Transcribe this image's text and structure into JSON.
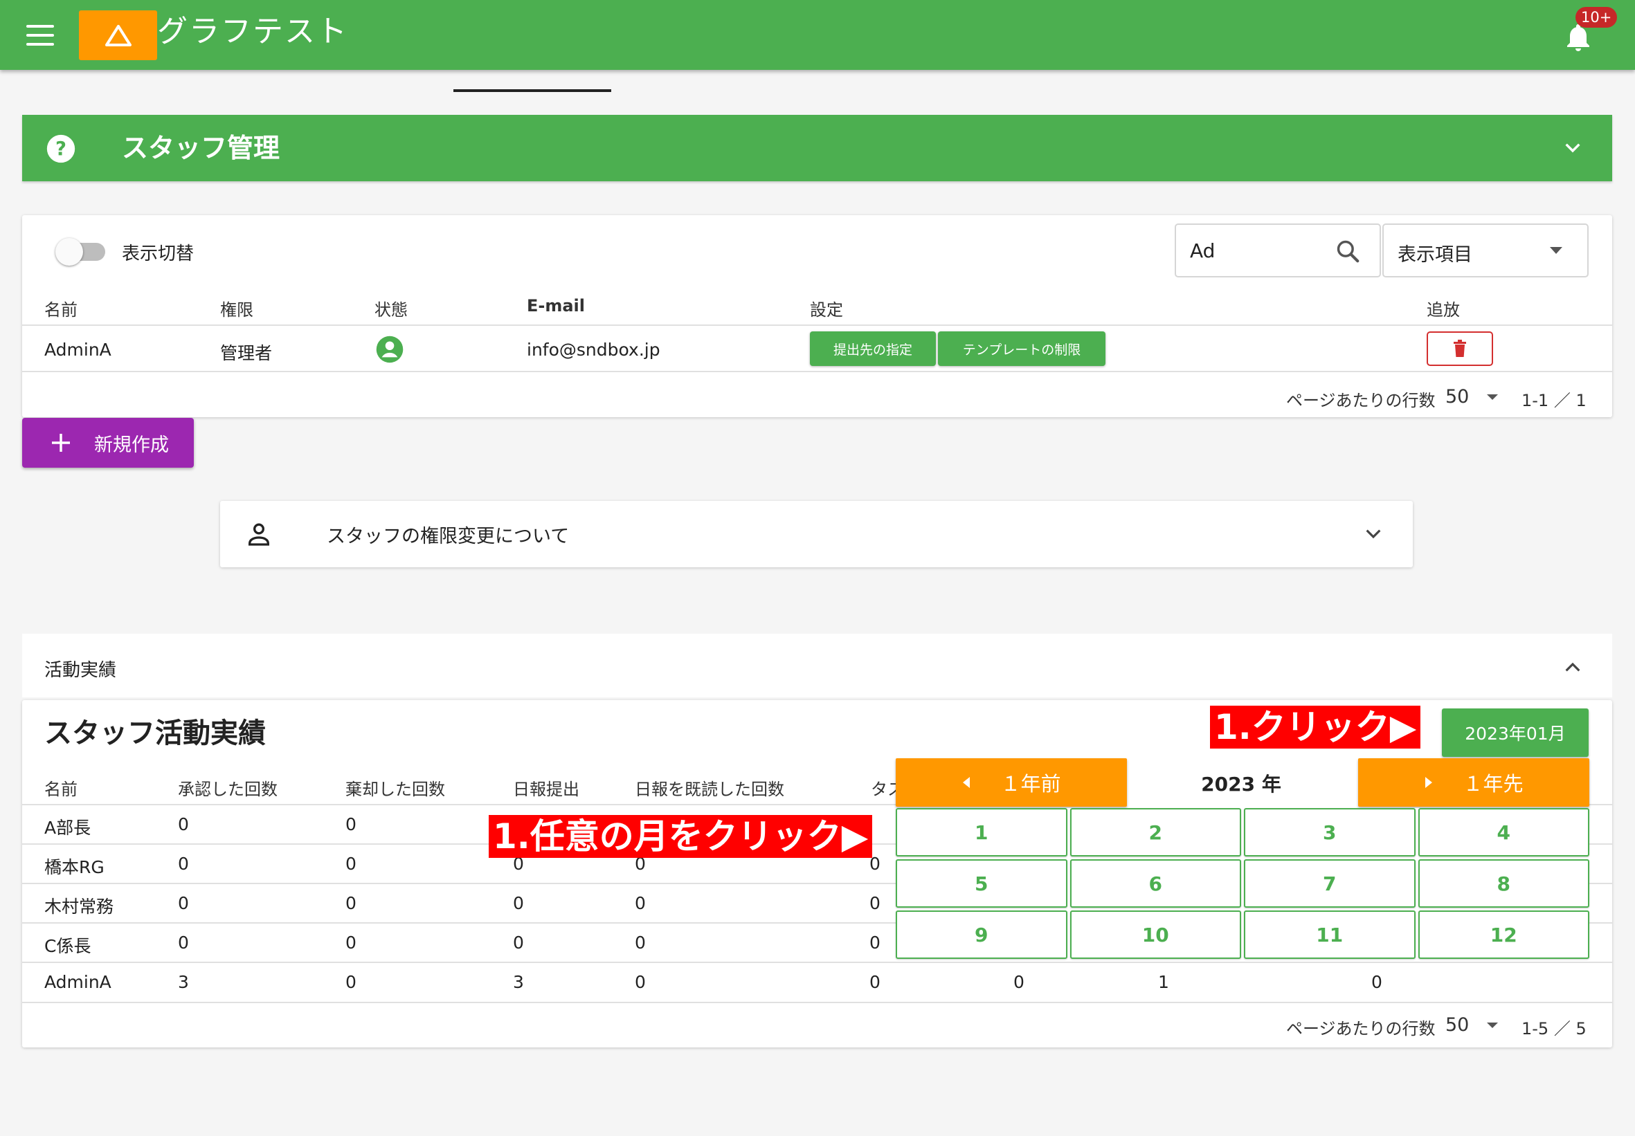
{
  "appbar": {
    "title": "グラフテスト",
    "notification_badge": "10+"
  },
  "banner": {
    "title": "スタッフ管理"
  },
  "staff_table": {
    "toggle_label": "表示切替",
    "search": {
      "value": "Ad"
    },
    "column_select": "表示項目",
    "headers": [
      "名前",
      "権限",
      "状態",
      "E-mail",
      "設定",
      "追放"
    ],
    "rows": [
      {
        "name": "AdminA",
        "role": "管理者",
        "email": "info@sndbox.jp",
        "btn_submit": "提出先の指定",
        "btn_template": "テンプレートの制限"
      }
    ],
    "pagination": {
      "rows_per_page_label": "ページあたりの行数",
      "rows_per_page": "50",
      "range": "1-1 ／ 1"
    }
  },
  "new_button": {
    "label": "新規作成"
  },
  "info_accordion": {
    "label": "スタッフの権限変更について"
  },
  "activity": {
    "section_label": "活動実績",
    "title": "スタッフ活動実績",
    "date_button": "2023年01月",
    "headers": [
      "名前",
      "承認した回数",
      "棄却した回数",
      "日報提出",
      "日報を既読した回数",
      "タス"
    ],
    "rows": [
      {
        "name": "A部長",
        "c1": "0",
        "c2": "0"
      },
      {
        "name": "橋本RG",
        "c1": "0",
        "c2": "0",
        "c3": "0",
        "c4": "0",
        "c5": "0"
      },
      {
        "name": "木村常務",
        "c1": "0",
        "c2": "0",
        "c3": "0",
        "c4": "0",
        "c5": "0"
      },
      {
        "name": "C係長",
        "c1": "0",
        "c2": "0",
        "c3": "0",
        "c4": "0",
        "c5": "0"
      },
      {
        "name": "AdminA",
        "c1": "3",
        "c2": "0",
        "c3": "3",
        "c4": "0",
        "c5": "0",
        "c6": "0",
        "c7": "1",
        "c8": "0"
      }
    ],
    "pagination": {
      "rows_per_page_label": "ページあたりの行数",
      "rows_per_page": "50",
      "range": "1-5 ／ 5"
    }
  },
  "month_picker": {
    "prev_year": "１年前",
    "year_label": "2023 年",
    "next_year": "１年先",
    "months": [
      "1",
      "2",
      "3",
      "4",
      "5",
      "6",
      "7",
      "8",
      "9",
      "10",
      "11",
      "12"
    ]
  },
  "annotations": {
    "click_note": "1.クリック▶",
    "month_note": "1.任意の月をクリック▶"
  },
  "colors": {
    "primary": "#4caf50",
    "accent_orange": "#ff9800",
    "new_button": "#9c27b0",
    "danger": "#d32f2f",
    "annotation": "#ff0000"
  }
}
